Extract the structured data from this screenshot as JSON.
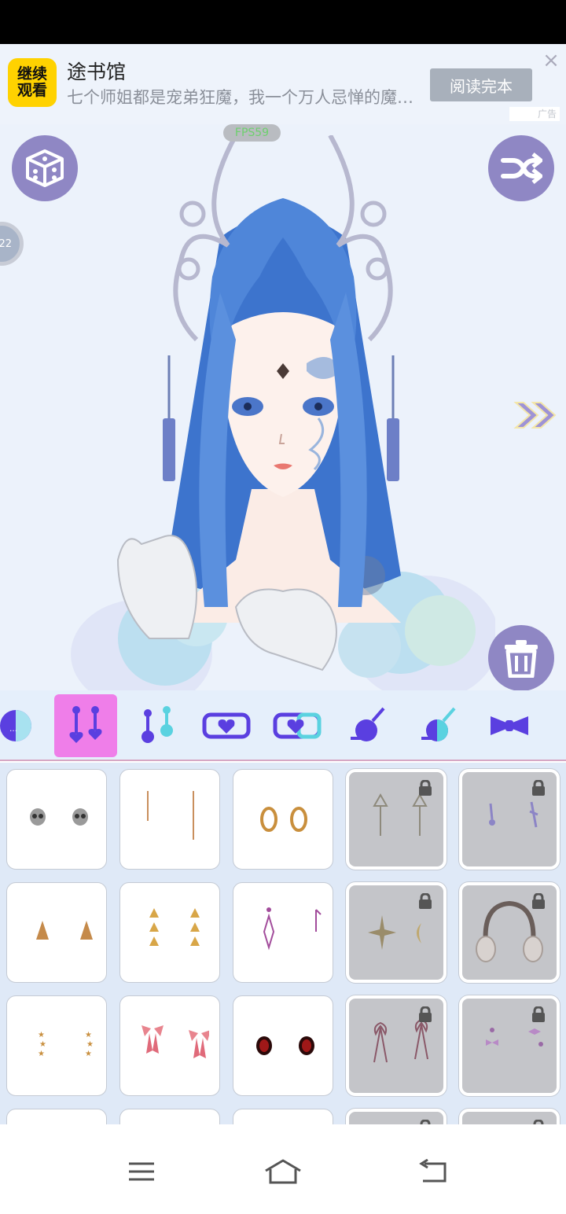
{
  "ad": {
    "logo_text": "继续\n观看",
    "title": "途书馆",
    "description": "七个师姐都是宠弟狂魔，我一个万人忌惮的魔…",
    "cta_label": "阅读完本",
    "close_icon": "close-icon",
    "tag": "广告"
  },
  "canvas": {
    "fps_label": "FPS59",
    "side_badge_text": "22",
    "buttons": [
      "dice-icon",
      "shuffle-icon",
      "trash-icon",
      "double-chevron-right-icon"
    ]
  },
  "categories": [
    {
      "icon": "half-circle-icon",
      "active": false
    },
    {
      "icon": "drop-earrings-icon",
      "active": true
    },
    {
      "icon": "stud-earrings-icon",
      "active": false
    },
    {
      "icon": "heart-choker-icon",
      "active": false
    },
    {
      "icon": "heart-choker-split-icon",
      "active": false
    },
    {
      "icon": "orb-wand-icon",
      "active": false
    },
    {
      "icon": "half-orb-wand-icon",
      "active": false
    },
    {
      "icon": "bow-tie-icon",
      "active": false
    }
  ],
  "items": [
    {
      "name": "skull-earrings",
      "locked": false
    },
    {
      "name": "bar-earrings",
      "locked": false
    },
    {
      "name": "hoop-earrings",
      "locked": false
    },
    {
      "name": "arrow-earrings",
      "locked": true
    },
    {
      "name": "charm-earrings",
      "locked": true
    },
    {
      "name": "triangle-studs",
      "locked": false
    },
    {
      "name": "triple-triangle-earrings",
      "locked": false
    },
    {
      "name": "diamond-drop-earrings",
      "locked": false
    },
    {
      "name": "star-moon-earrings",
      "locked": true
    },
    {
      "name": "earmuffs",
      "locked": true
    },
    {
      "name": "star-stack-earrings",
      "locked": false
    },
    {
      "name": "pink-bow-earrings",
      "locked": false
    },
    {
      "name": "red-stud-earrings",
      "locked": false
    },
    {
      "name": "ribbon-earrings",
      "locked": true
    },
    {
      "name": "bow-charm-earrings",
      "locked": true
    }
  ],
  "nav": {
    "buttons": [
      "menu-icon",
      "home-icon",
      "back-icon"
    ]
  },
  "colors": {
    "accent_purple": "#8f87c4",
    "active_pink": "#ef7ee9",
    "icon_blue": "#5a3fe0",
    "hair_blue": "#4f86d9"
  }
}
